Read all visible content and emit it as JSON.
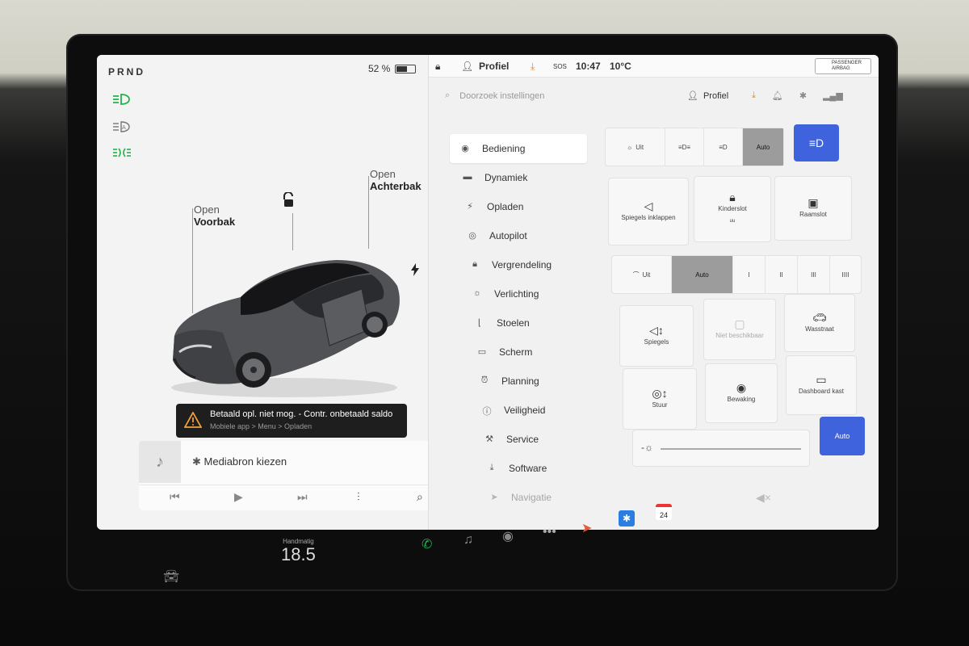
{
  "status_left": {
    "gear": "PRND",
    "battery_pct": "52 %",
    "battery_level": 0.52
  },
  "doors": {
    "frunk_state": "Open",
    "frunk_name": "Voorbak",
    "trunk_state": "Open",
    "trunk_name": "Achterbak"
  },
  "alert": {
    "title": "Betaald opl. niet mog. - Contr. onbetaald saldo",
    "subtitle": "Mobiele app > Menu > Opladen"
  },
  "media": {
    "source_label": "Mediabron kiezen"
  },
  "topbar": {
    "profile": "Profiel",
    "sos": "SOS",
    "time": "10:47",
    "temp": "10°C",
    "passenger_airbag": "PASSENGER AIRBAG"
  },
  "header": {
    "search_placeholder": "Doorzoek instellingen",
    "profile": "Profiel"
  },
  "menu": [
    {
      "label": "Bediening",
      "icon": "toggle-icon"
    },
    {
      "label": "Dynamiek",
      "icon": "car-icon"
    },
    {
      "label": "Opladen",
      "icon": "bolt-icon"
    },
    {
      "label": "Autopilot",
      "icon": "steering-wheel-icon"
    },
    {
      "label": "Vergrendeling",
      "icon": "lock-icon"
    },
    {
      "label": "Verlichting",
      "icon": "sun-icon"
    },
    {
      "label": "Stoelen",
      "icon": "seat-icon"
    },
    {
      "label": "Scherm",
      "icon": "display-icon"
    },
    {
      "label": "Planning",
      "icon": "alarm-icon"
    },
    {
      "label": "Veiligheid",
      "icon": "info-icon"
    },
    {
      "label": "Service",
      "icon": "wrench-icon"
    },
    {
      "label": "Software",
      "icon": "download-icon"
    },
    {
      "label": "Navigatie",
      "icon": "navigation-icon"
    }
  ],
  "lights": {
    "off": "Uit",
    "auto": "Auto"
  },
  "tiles_row1": [
    {
      "label": "Spiegels inklappen",
      "icon": "mirror-icon"
    },
    {
      "label": "Kinderslot",
      "sub": "uu",
      "icon": "child-lock-icon"
    },
    {
      "label": "Raamslot",
      "icon": "window-lock-icon"
    }
  ],
  "wipers": {
    "off": "Uit",
    "auto": "Auto",
    "levels": [
      "I",
      "II",
      "III",
      "IIII"
    ]
  },
  "tiles_row3": [
    {
      "label": "Spiegels",
      "icon": "mirror-adjust-icon"
    },
    {
      "label": "Niet beschikbaar",
      "icon": "unavailable-icon"
    },
    {
      "label": "Wasstraat",
      "icon": "car-wash-icon"
    }
  ],
  "tiles_row4": [
    {
      "label": "Stuur",
      "icon": "steering-adjust-icon"
    },
    {
      "label": "Bewaking",
      "icon": "sentry-icon"
    },
    {
      "label": "Dashboard kast",
      "icon": "glovebox-icon"
    }
  ],
  "brightness": {
    "auto": "Auto"
  },
  "dock": {
    "climate_label": "Handmatig",
    "climate_temp": "18.5",
    "calendar_day": "24"
  }
}
